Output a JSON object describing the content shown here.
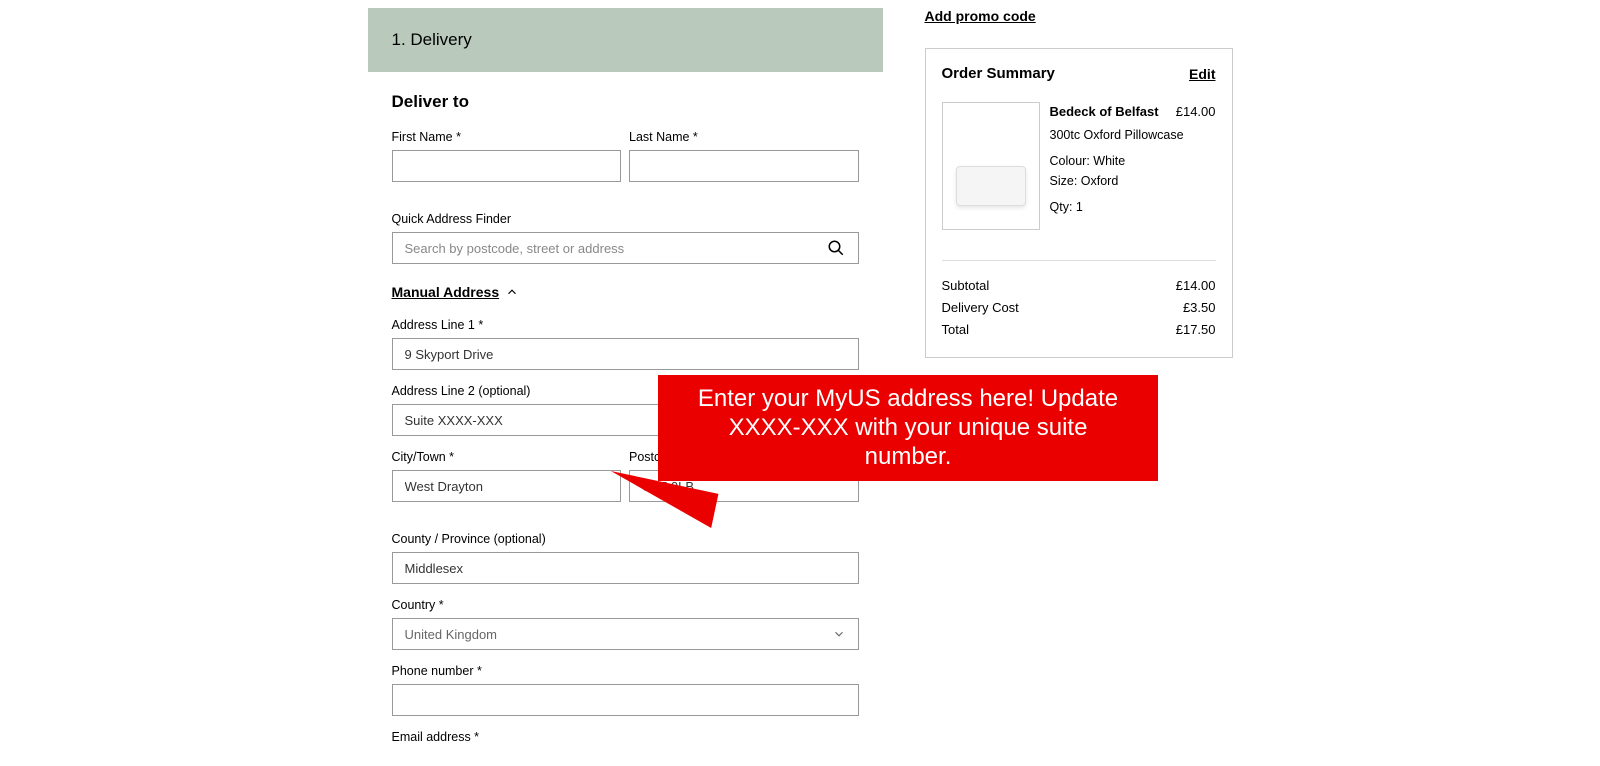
{
  "step": {
    "title": "1. Delivery"
  },
  "deliverTo": {
    "heading": "Deliver to",
    "firstNameLabel": "First Name *",
    "lastNameLabel": "Last Name *",
    "quickAddressLabel": "Quick Address Finder",
    "quickAddressPlaceholder": "Search by postcode, street or address",
    "manualAddress": "Manual Address",
    "addressLine1Label": "Address Line 1 *",
    "addressLine1Value": "9 Skyport Drive",
    "addressLine2Label": "Address Line 2 (optional)",
    "addressLine2Value": "Suite XXXX-XXX",
    "cityLabel": "City/Town *",
    "cityValue": "West Drayton",
    "postcodeLabel": "Postcode *",
    "postcodeValue": "UB7 0LB",
    "countyLabel": "County / Province (optional)",
    "countyValue": "Middlesex",
    "countryLabel": "Country *",
    "countryValue": "United Kingdom",
    "phoneLabel": "Phone number *",
    "emailLabel": "Email address *"
  },
  "sidebar": {
    "promoLink": "Add promo code",
    "summaryTitle": "Order Summary",
    "editLabel": "Edit",
    "product": {
      "brand": "Bedeck of Belfast",
      "name": "300tc Oxford Pillowcase",
      "colour": "Colour: White",
      "size": "Size: Oxford",
      "qty": "Qty: 1",
      "price": "£14.00"
    },
    "totals": {
      "subtotalLabel": "Subtotal",
      "subtotalValue": "£14.00",
      "deliveryLabel": "Delivery Cost",
      "deliveryValue": "£3.50",
      "totalLabel": "Total",
      "totalValue": "£17.50"
    }
  },
  "callout": {
    "text": "Enter your MyUS address here! Update XXXX-XXX with your unique suite number."
  }
}
